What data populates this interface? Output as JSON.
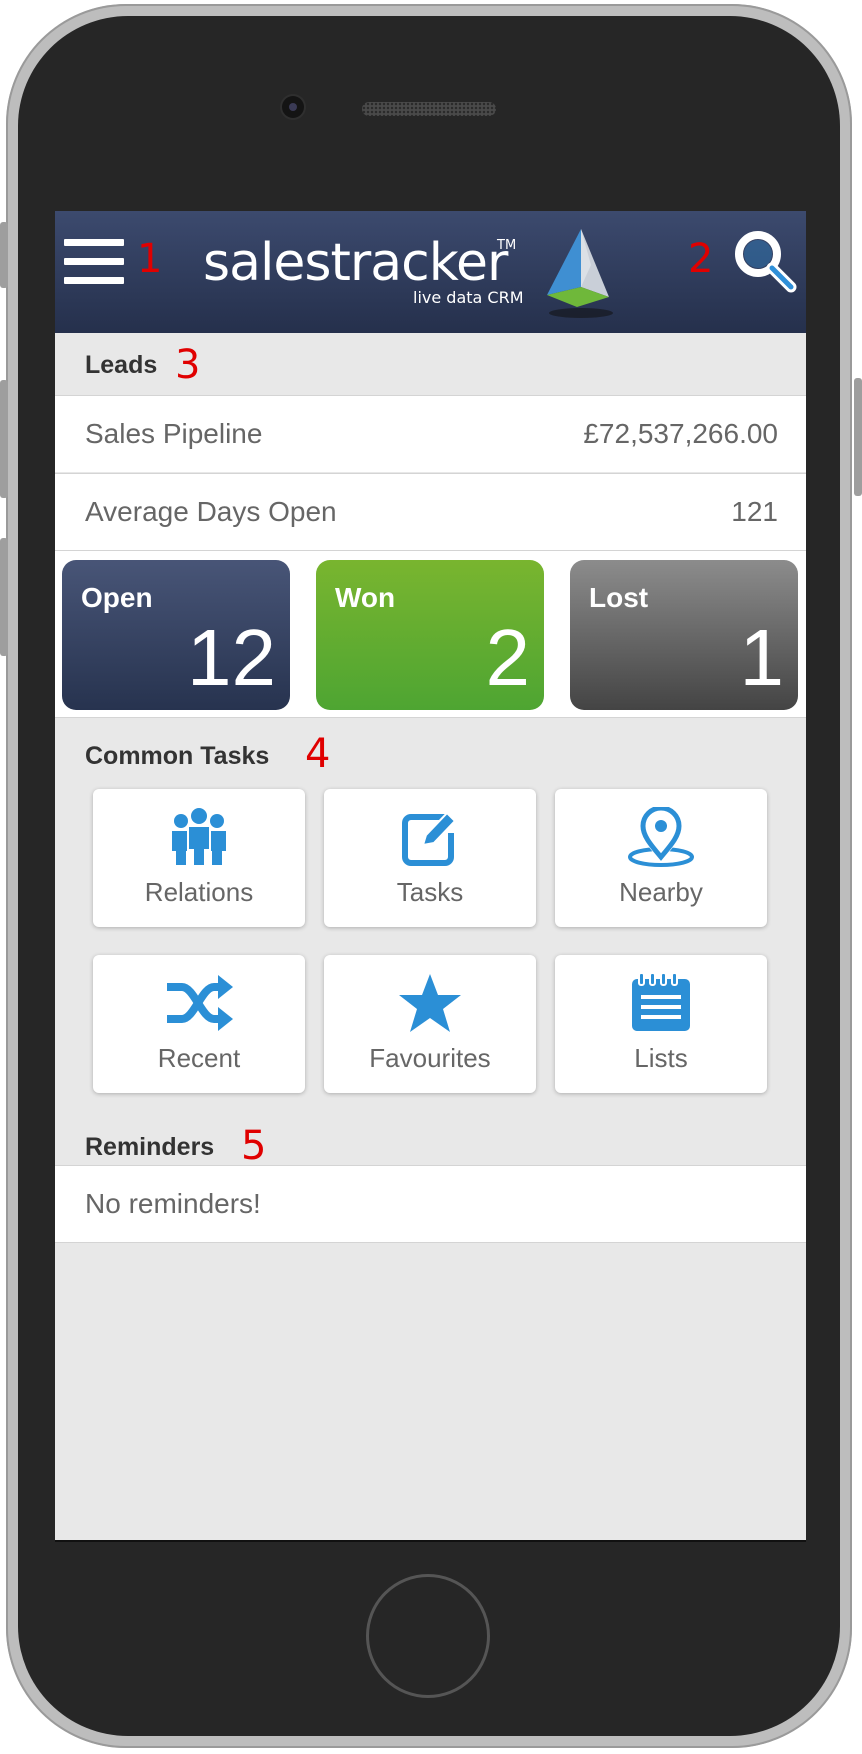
{
  "header": {
    "logo_name": "salestracker",
    "logo_trademark": "TM",
    "logo_tagline": "live data CRM",
    "menu_icon": "hamburger-menu-icon",
    "search_icon": "magnifier-search-icon",
    "color": "#2c3756"
  },
  "annotations": [
    "1",
    "2",
    "3",
    "4",
    "5"
  ],
  "leads": {
    "title": "Leads",
    "rows": [
      {
        "label": "Sales Pipeline",
        "value": "£72,537,266.00"
      },
      {
        "label": "Average Days Open",
        "value": "121"
      }
    ],
    "stats": [
      {
        "label": "Open",
        "count": "12",
        "color": "#36425f"
      },
      {
        "label": "Won",
        "count": "2",
        "color": "#62ad30"
      },
      {
        "label": "Lost",
        "count": "1",
        "color": "#6a6a6a"
      }
    ]
  },
  "common_tasks": {
    "title": "Common Tasks",
    "tiles": [
      {
        "label": "Relations",
        "icon": "people-group-icon"
      },
      {
        "label": "Tasks",
        "icon": "edit-square-icon"
      },
      {
        "label": "Nearby",
        "icon": "location-pin-icon"
      },
      {
        "label": "Recent",
        "icon": "shuffle-icon"
      },
      {
        "label": "Favourites",
        "icon": "star-icon"
      },
      {
        "label": "Lists",
        "icon": "notepad-list-icon"
      }
    ],
    "icon_color": "#2b8fd6"
  },
  "reminders": {
    "title": "Reminders",
    "empty_text": "No reminders!"
  }
}
